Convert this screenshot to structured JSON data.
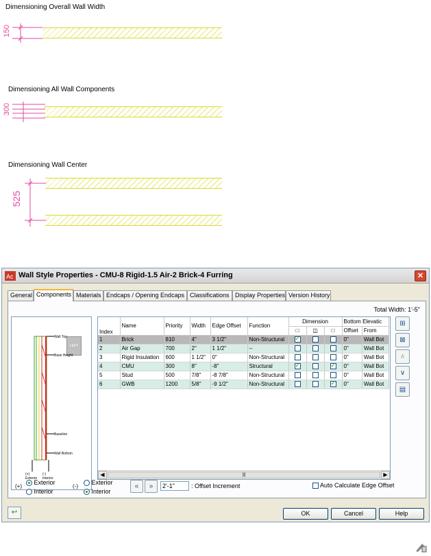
{
  "figures": {
    "overall_title": "Dimensioning Overall Wall Width",
    "overall_dim": "150",
    "components_title": "Dimensioning All Wall Components",
    "components_dim": "300",
    "center_title": "Dimensioning Wall Center",
    "center_dim": "525"
  },
  "dialog": {
    "title": "Wall Style Properties - CMU-8 Rigid-1.5 Air-2 Brick-4 Furring",
    "close_label": "✕",
    "tabs": [
      {
        "label": "General"
      },
      {
        "label": "Components"
      },
      {
        "label": "Materials"
      },
      {
        "label": "Endcaps / Opening Endcaps"
      },
      {
        "label": "Classifications"
      },
      {
        "label": "Display Properties"
      },
      {
        "label": "Version History"
      }
    ],
    "total_width": "Total Width: 1'-5\"",
    "preview_labels": {
      "view": "LEFT",
      "wall_top": "Wall Top",
      "base_height": "Base Height",
      "baseline": "Baseline",
      "wall_bottom": "Wall Bottom",
      "exterior": "(+) Exterior",
      "interior": "(-) Interior"
    },
    "table": {
      "headers": {
        "index": "Index",
        "name": "Name",
        "priority": "Priority",
        "width": "Width",
        "edge_offset": "Edge Offset",
        "function": "Function",
        "dimension": "Dimension",
        "bottom_elevation": "Bottom Elevatic",
        "offset": "Offset",
        "from": "From"
      },
      "rows": [
        {
          "index": "1",
          "name": "Brick",
          "priority": "810",
          "width": "4\"",
          "edge_offset": "3 1/2\"",
          "function": "Non-Structural",
          "d1": true,
          "d2": false,
          "d3": false,
          "offset": "0\"",
          "from": "Wall Bot"
        },
        {
          "index": "2",
          "name": "Air Gap",
          "priority": "700",
          "width": "2\"",
          "edge_offset": "1 1/2\"",
          "function": "--",
          "d1": false,
          "d2": false,
          "d3": false,
          "offset": "0\"",
          "from": "Wall Bot"
        },
        {
          "index": "3",
          "name": "Rigid Insulation",
          "priority": "600",
          "width": "1 1/2\"",
          "edge_offset": "0\"",
          "function": "Non-Structural",
          "d1": false,
          "d2": false,
          "d3": false,
          "offset": "0\"",
          "from": "Wall Bot"
        },
        {
          "index": "4",
          "name": "CMU",
          "priority": "300",
          "width": "8\"",
          "edge_offset": "-8\"",
          "function": "Structural",
          "d1": true,
          "d2": false,
          "d3": true,
          "offset": "0\"",
          "from": "Wall Bot"
        },
        {
          "index": "5",
          "name": "Stud",
          "priority": "500",
          "width": "7/8\"",
          "edge_offset": "-8 7/8\"",
          "function": "Non-Structural",
          "d1": false,
          "d2": false,
          "d3": false,
          "offset": "0\"",
          "from": "Wall Bot"
        },
        {
          "index": "6",
          "name": "GWB",
          "priority": "1200",
          "width": "5/8\"",
          "edge_offset": "-9 1/2\"",
          "function": "Non-Structural",
          "d1": false,
          "d2": false,
          "d3": true,
          "offset": "0\"",
          "from": "Wall Bot"
        }
      ]
    },
    "bottom": {
      "plus_label": "(+)",
      "minus_label": "(-)",
      "exterior": "Exterior",
      "interior": "Interior",
      "offset_value": "2'-1\"",
      "offset_increment": ": Offset Increment",
      "auto_calc": "Auto Calculate Edge Offset"
    },
    "buttons": {
      "ok": "OK",
      "cancel": "Cancel",
      "help": "Help"
    }
  }
}
